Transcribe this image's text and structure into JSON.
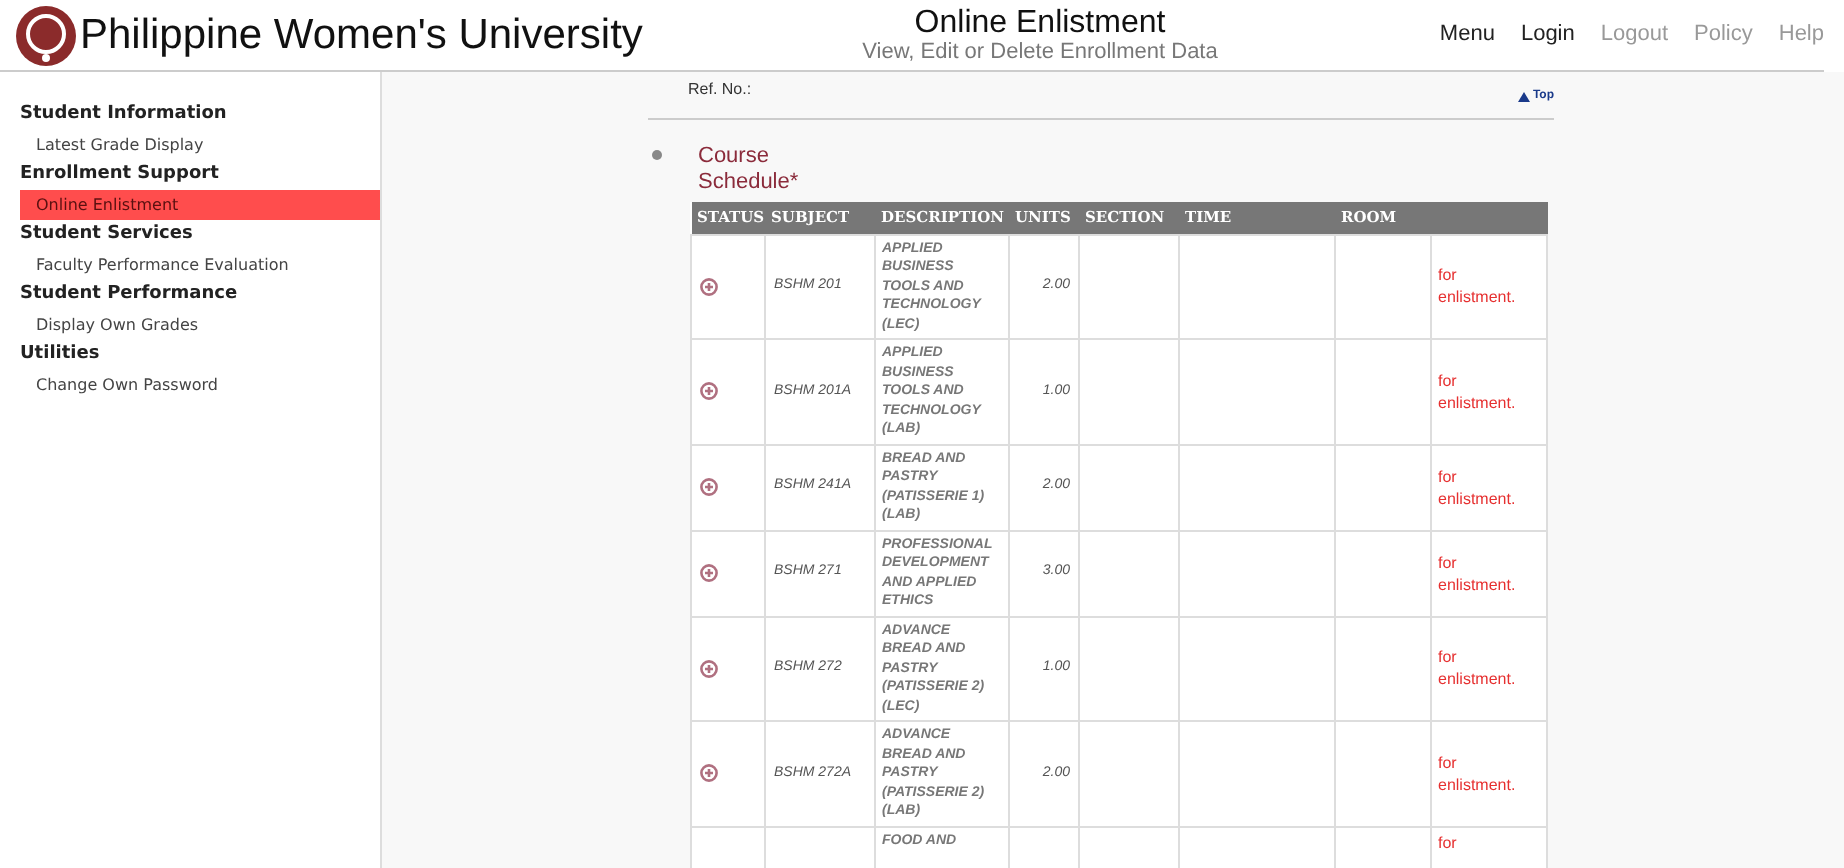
{
  "header": {
    "brand": "Philippine Women's University",
    "title": "Online Enlistment",
    "subtitle": "View, Edit or Delete Enrollment Data",
    "nav": [
      {
        "label": "Menu",
        "enabled": true
      },
      {
        "label": "Login",
        "enabled": true
      },
      {
        "label": "Logout",
        "enabled": false
      },
      {
        "label": "Policy",
        "enabled": false
      },
      {
        "label": "Help",
        "enabled": false
      }
    ]
  },
  "sidebar": {
    "sections": [
      {
        "heading": "Student Information",
        "items": [
          {
            "label": "Latest Grade Display",
            "selected": false
          }
        ]
      },
      {
        "heading": "Enrollment Support",
        "items": [
          {
            "label": "Online Enlistment",
            "selected": true
          }
        ]
      },
      {
        "heading": "Student Services",
        "items": [
          {
            "label": "Faculty Performance Evaluation",
            "selected": false
          }
        ]
      },
      {
        "heading": "Student Performance",
        "items": [
          {
            "label": "Display Own Grades",
            "selected": false
          }
        ]
      },
      {
        "heading": "Utilities",
        "items": [
          {
            "label": "Change Own Password",
            "selected": false
          }
        ]
      }
    ]
  },
  "main": {
    "ref_label": "Ref. No.:",
    "top_link": "Top",
    "section_title": "Course Schedule*",
    "table": {
      "columns": [
        "STATUS",
        "SUBJECT",
        "DESCRIPTION",
        "UNITS",
        "SECTION",
        "TIME",
        "ROOM"
      ],
      "rows": [
        {
          "subject": "BSHM 201",
          "description": "APPLIED BUSINESS TOOLS AND TECHNOLOGY (LEC)",
          "units": "2.00",
          "status": "for enlistment."
        },
        {
          "subject": "BSHM 201A",
          "description": "APPLIED BUSINESS TOOLS AND TECHNOLOGY (LAB)",
          "units": "1.00",
          "status": "for enlistment."
        },
        {
          "subject": "BSHM 241A",
          "description": "BREAD AND PASTRY (PATISSERIE 1) (LAB)",
          "units": "2.00",
          "status": "for enlistment."
        },
        {
          "subject": "BSHM 271",
          "description": "PROFESSIONAL DEVELOPMENT AND APPLIED ETHICS",
          "units": "3.00",
          "status": "for enlistment."
        },
        {
          "subject": "BSHM 272",
          "description": "ADVANCE BREAD AND PASTRY (PATISSERIE 2) (LEC)",
          "units": "1.00",
          "status": "for enlistment."
        },
        {
          "subject": "BSHM 272A",
          "description": "ADVANCE BREAD AND PASTRY (PATISSERIE 2) (LAB)",
          "units": "2.00",
          "status": "for enlistment."
        },
        {
          "description": "FOOD AND",
          "status": "for"
        }
      ]
    }
  }
}
